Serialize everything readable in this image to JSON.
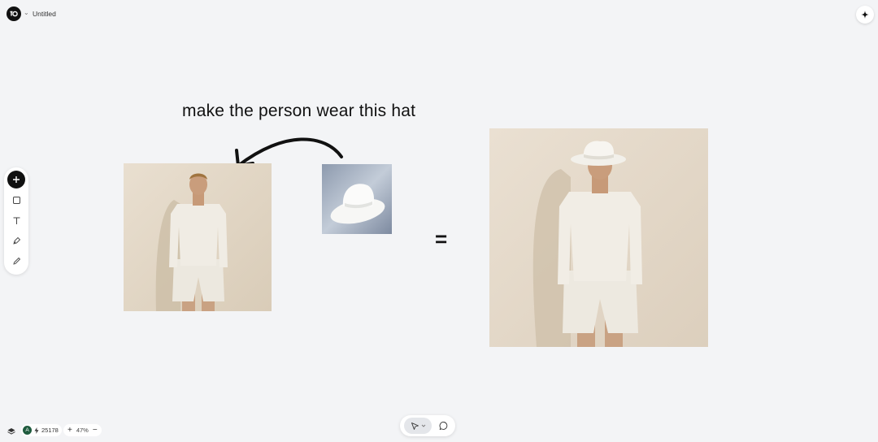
{
  "header": {
    "doc_title": "Untitled"
  },
  "canvas": {
    "caption": "make the person wear this hat",
    "equals": "="
  },
  "icons": {
    "logo": "app-logo-icon",
    "assistant": "sparkle-icon",
    "toolbar": [
      "plus-icon",
      "rectangle-icon",
      "text-icon",
      "pen-icon",
      "pencil-icon"
    ],
    "layers": "layers-icon",
    "select": "cursor-icon",
    "comment": "comment-icon"
  },
  "footer": {
    "avatar_initial": "A",
    "credits": "25178",
    "zoom_in": "+",
    "zoom_level": "47%",
    "zoom_out": "−"
  },
  "colors": {
    "canvas_bg": "#f3f4f6",
    "wall": "#e6dccd",
    "accent": "#111111",
    "avatar": "#1f5b3e"
  }
}
